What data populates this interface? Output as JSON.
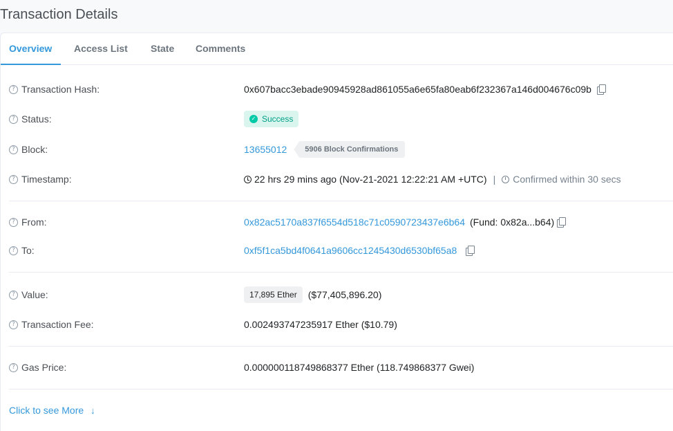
{
  "page_title": "Transaction Details",
  "tabs": [
    {
      "label": "Overview",
      "active": true
    },
    {
      "label": "Access List",
      "active": false
    },
    {
      "label": "State",
      "active": false
    },
    {
      "label": "Comments",
      "active": false
    }
  ],
  "details": {
    "tx_hash": {
      "label": "Transaction Hash:",
      "value": "0x607bacc3ebade90945928ad861055a6e65fa80eab6f232367a146d004676c09b"
    },
    "status": {
      "label": "Status:",
      "value": "Success"
    },
    "block": {
      "label": "Block:",
      "value": "13655012",
      "confirmations": "5906 Block Confirmations"
    },
    "timestamp": {
      "label": "Timestamp:",
      "value": "22 hrs 29 mins ago (Nov-21-2021 12:22:21 AM +UTC)",
      "separator": "|",
      "confirmed": "Confirmed within 30 secs"
    },
    "from": {
      "label": "From:",
      "address": "0x82ac5170a837f6554d518c71c0590723437e6b64",
      "fund": "(Fund: 0x82a...b64)"
    },
    "to": {
      "label": "To:",
      "address": "0xf5f1ca5bd4f0641a9606cc1245430d6530bf65a8"
    },
    "value": {
      "label": "Value:",
      "ether": "17,895 Ether",
      "usd": "($77,405,896.20)"
    },
    "fee": {
      "label": "Transaction Fee:",
      "value": "0.002493747235917 Ether ($10.79)"
    },
    "gas_price": {
      "label": "Gas Price:",
      "value": "0.000000118749868377 Ether (118.749868377 Gwei)"
    }
  },
  "see_more": {
    "label": "Click to see More",
    "icon": "arrow-down-icon"
  },
  "colors": {
    "accent": "#3498db",
    "success": "#00c9a7",
    "success_bg": "#daf4ee"
  }
}
